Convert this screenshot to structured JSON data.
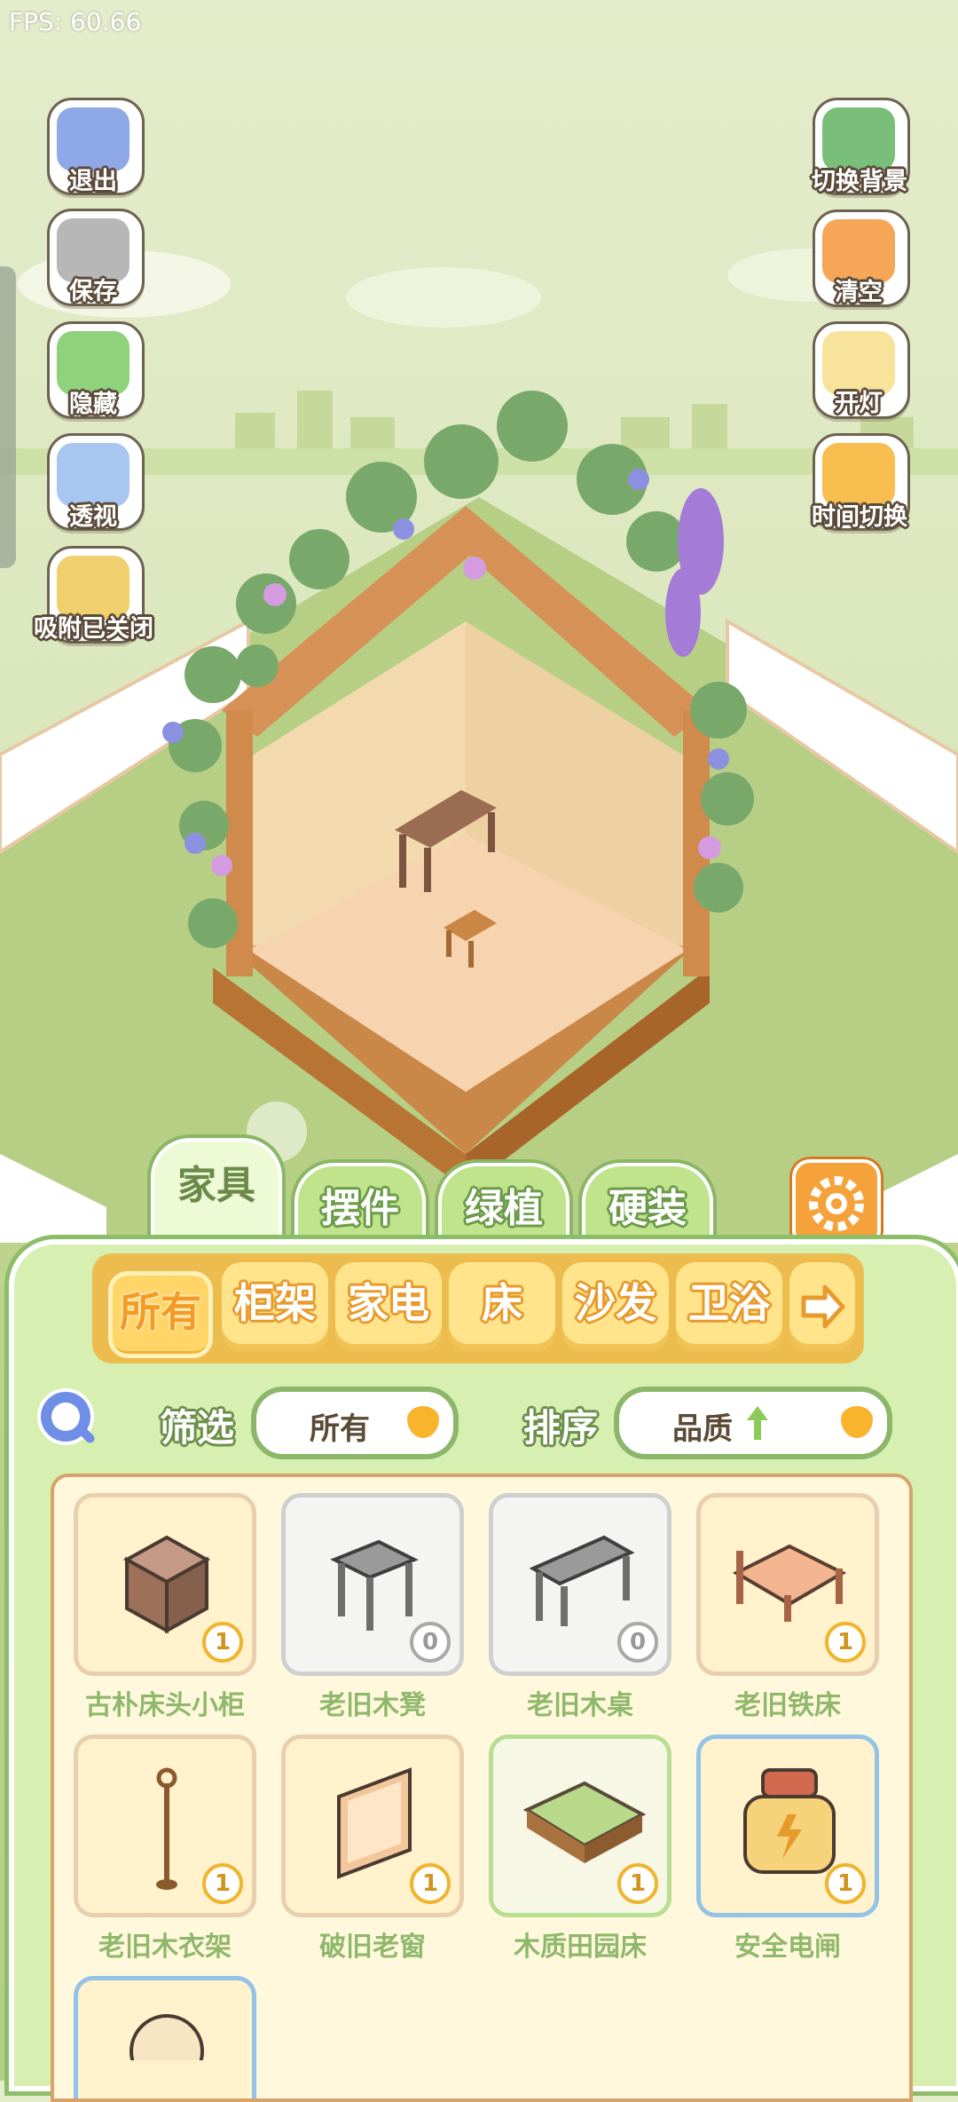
{
  "fps_text": "FPS: 60.66",
  "left_buttons": [
    {
      "label": "退出",
      "icon": "exit-icon"
    },
    {
      "label": "保存",
      "icon": "save-icon"
    },
    {
      "label": "隐藏",
      "icon": "hide-icon"
    },
    {
      "label": "透视",
      "icon": "perspective-icon"
    },
    {
      "label": "吸附已关闭",
      "icon": "snap-icon"
    }
  ],
  "right_buttons": [
    {
      "label": "切换背景",
      "icon": "background-icon"
    },
    {
      "label": "清空",
      "icon": "clear-icon"
    },
    {
      "label": "开灯",
      "icon": "light-icon"
    },
    {
      "label": "时间切换",
      "icon": "time-icon"
    }
  ],
  "tabs": [
    {
      "label": "家具",
      "active": true
    },
    {
      "label": "摆件",
      "active": false
    },
    {
      "label": "绿植",
      "active": false
    },
    {
      "label": "硬装",
      "active": false
    }
  ],
  "settings_icon": "gear-icon",
  "categories": [
    {
      "label": "所有",
      "active": true
    },
    {
      "label": "柜架",
      "active": false
    },
    {
      "label": "家电",
      "active": false
    },
    {
      "label": "床",
      "active": false
    },
    {
      "label": "沙发",
      "active": false
    },
    {
      "label": "卫浴",
      "active": false
    }
  ],
  "next_arrow": "arrow-right-icon",
  "search_icon": "search-icon",
  "filter": {
    "label": "筛选",
    "value": "所有"
  },
  "sort": {
    "label": "排序",
    "value": "品质"
  },
  "items": [
    {
      "name": "古朴床头小柜",
      "qty": "1",
      "style": "normal"
    },
    {
      "name": "老旧木凳",
      "qty": "0",
      "style": "gray"
    },
    {
      "name": "老旧木桌",
      "qty": "0",
      "style": "gray"
    },
    {
      "name": "老旧铁床",
      "qty": "1",
      "style": "normal"
    },
    {
      "name": "老旧木衣架",
      "qty": "1",
      "style": "normal"
    },
    {
      "name": "破旧老窗",
      "qty": "1",
      "style": "normal"
    },
    {
      "name": "木质田园床",
      "qty": "1",
      "style": "green"
    },
    {
      "name": "安全电闸",
      "qty": "1",
      "style": "blue"
    }
  ],
  "colors": {
    "accent_green": "#8dbd69",
    "accent_orange": "#f6a23b",
    "item_name": "#8fb86b"
  }
}
